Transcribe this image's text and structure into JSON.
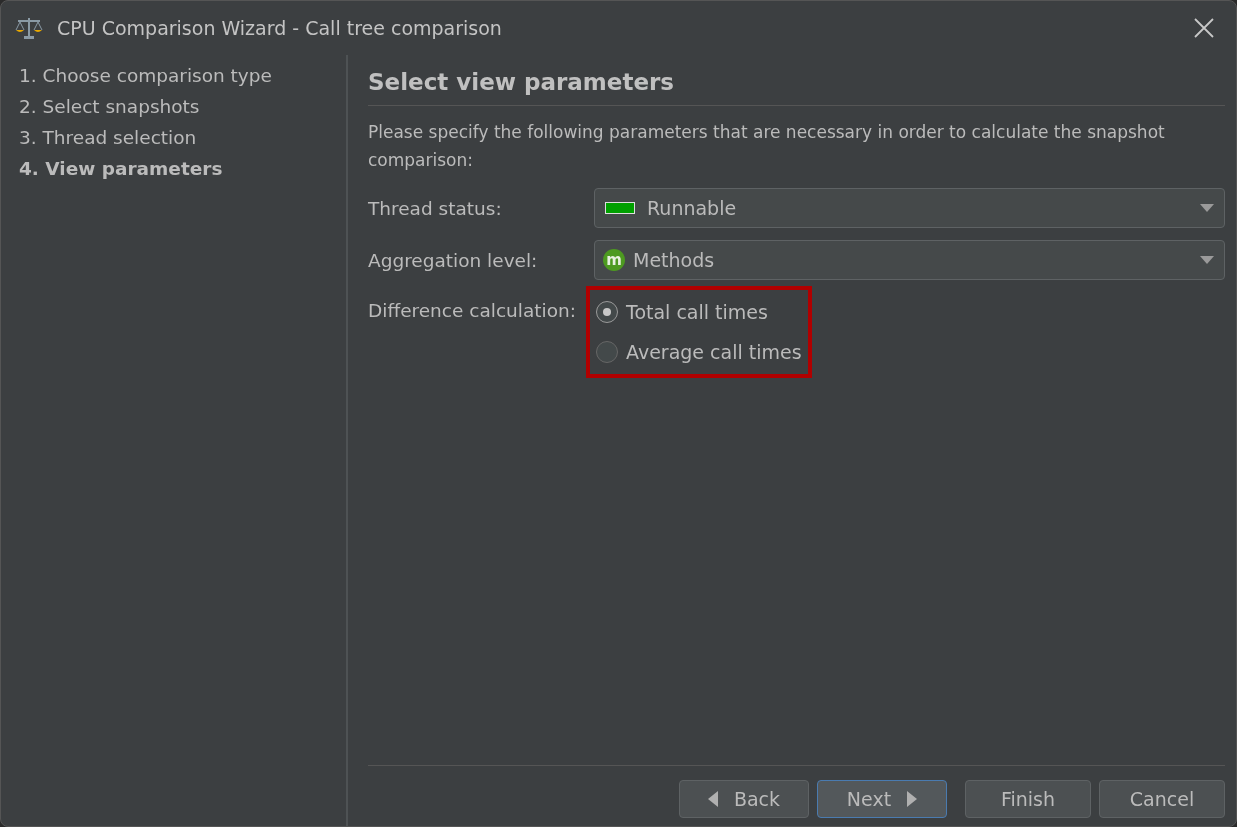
{
  "window": {
    "title": "CPU Comparison Wizard - Call tree comparison"
  },
  "steps": [
    {
      "label": "1. Choose comparison type",
      "selected": false
    },
    {
      "label": "2. Select snapshots",
      "selected": false
    },
    {
      "label": "3. Thread selection",
      "selected": false
    },
    {
      "label": "4. View parameters",
      "selected": true
    }
  ],
  "page": {
    "heading": "Select view parameters",
    "description": "Please specify the following parameters that are necessary in order to calculate the snapshot comparison:"
  },
  "thread_status": {
    "label": "Thread status:",
    "value": "Runnable",
    "color": "#00a000"
  },
  "aggregation_level": {
    "label": "Aggregation level:",
    "value": "Methods",
    "icon_letter": "m"
  },
  "difference_calculation": {
    "label": "Difference calculation:",
    "highlighted": true,
    "options": [
      {
        "label": "Total call times",
        "selected": true
      },
      {
        "label": "Average call times",
        "selected": false
      }
    ]
  },
  "buttons": [
    {
      "label": "Back",
      "kind": "back",
      "focused": false
    },
    {
      "label": "Next",
      "kind": "next",
      "focused": true
    },
    {
      "label": "Finish",
      "kind": "plain",
      "focused": false
    },
    {
      "label": "Cancel",
      "kind": "plain",
      "focused": false
    }
  ]
}
